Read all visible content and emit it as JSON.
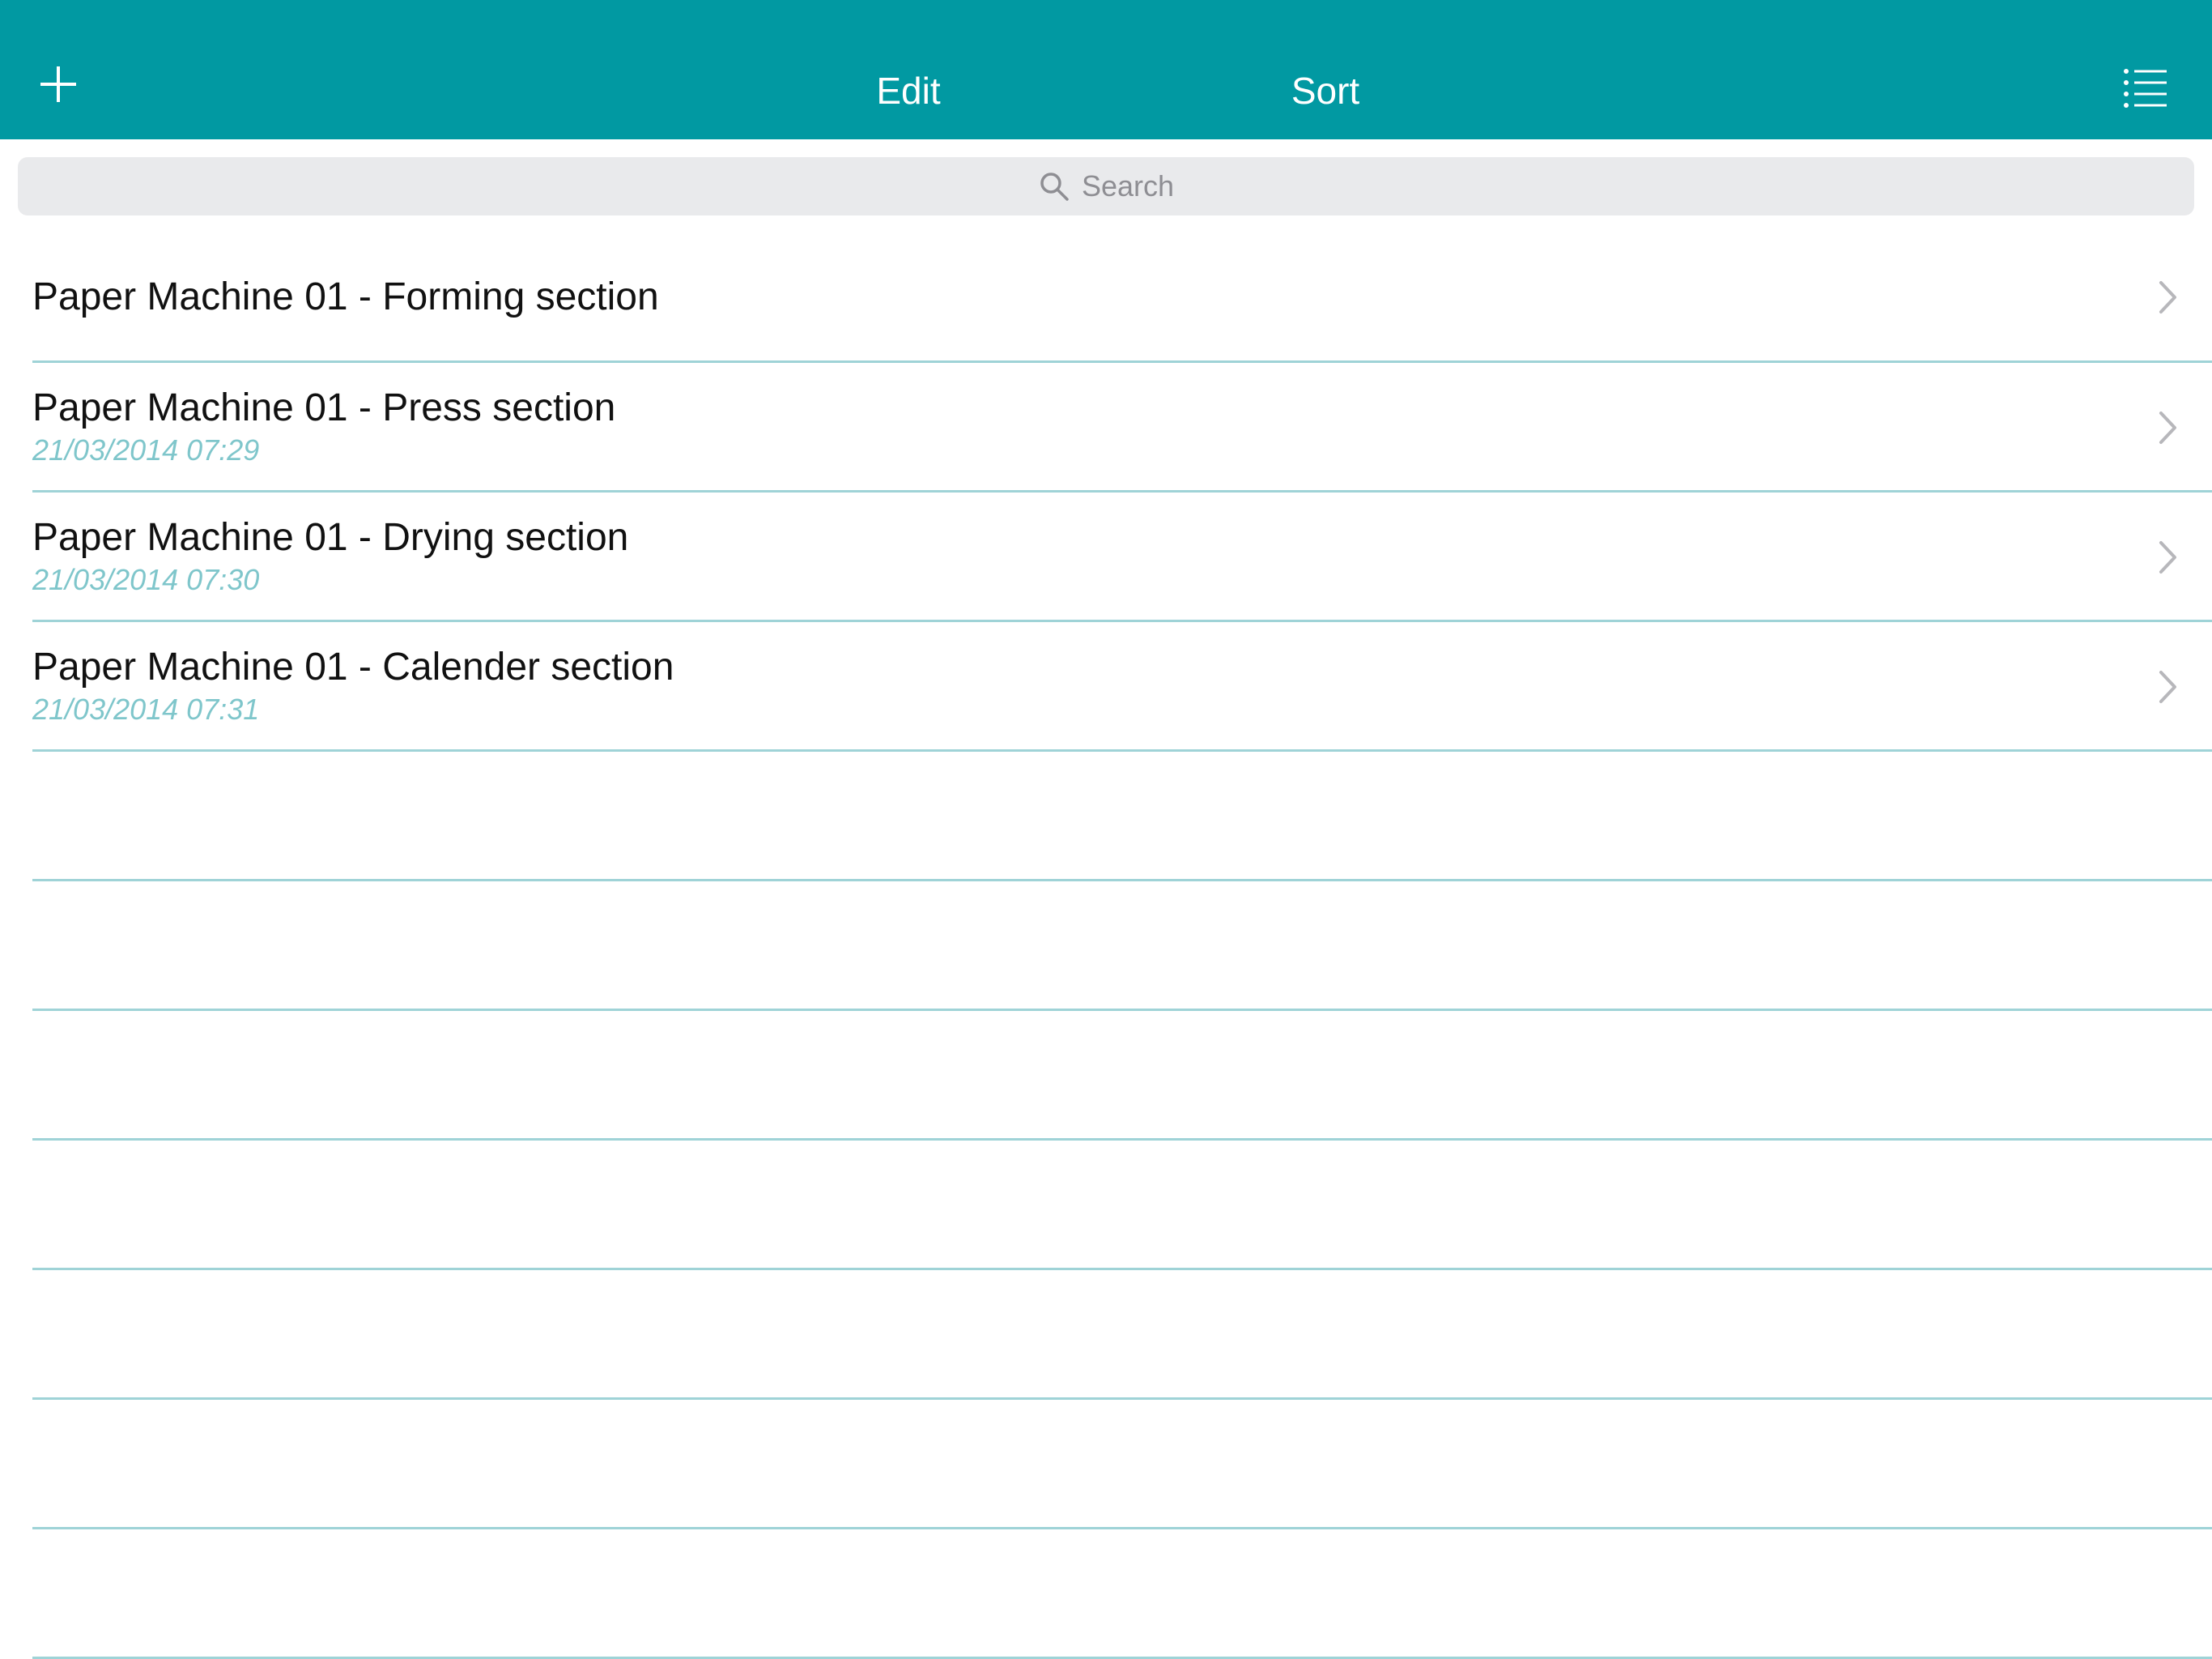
{
  "navbar": {
    "add_icon": "plus-icon",
    "edit_label": "Edit",
    "sort_label": "Sort",
    "menu_icon": "list-menu-icon",
    "background_color": "#0199a2"
  },
  "search": {
    "icon": "search-icon",
    "placeholder": "Search"
  },
  "list": {
    "items": [
      {
        "title": "Paper Machine 01 - Forming section",
        "date": ""
      },
      {
        "title": "Paper Machine 01 - Press section",
        "date": "21/03/2014 07:29"
      },
      {
        "title": "Paper Machine 01 - Drying section",
        "date": "21/03/2014 07:30"
      },
      {
        "title": "Paper Machine 01 - Calender section",
        "date": "21/03/2014 07:31"
      }
    ],
    "chevron_icon": "chevron-right-icon",
    "separator_color": "#9fd3d7",
    "date_color": "#7fc6cb"
  }
}
